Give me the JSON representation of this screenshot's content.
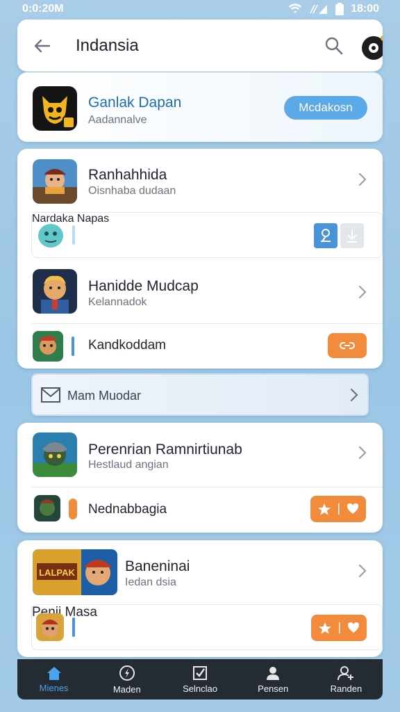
{
  "status_bar": {
    "time": "0:0:20M",
    "clock": "18:00"
  },
  "header": {
    "title": "Indansia",
    "back_icon": "arrow-left-icon",
    "search_icon": "search-icon",
    "profile_icon": "avatar-icon"
  },
  "featured": {
    "name": "Ganlak Dapan",
    "subtitle": "Aadannalve",
    "button": "Mcdakosn"
  },
  "group1": {
    "item1": {
      "title": "Ranhahhida",
      "subtitle": "Oisnhaba dudaan"
    },
    "item2": {
      "title": "Nardaka Napas"
    },
    "item3": {
      "title": "Hanidde Mudcap",
      "subtitle": "Kelannadok"
    },
    "item4": {
      "title": "Kandkoddam"
    }
  },
  "mail_bar": {
    "label": "Mam Muodar"
  },
  "group2": {
    "item1": {
      "title": "Perenrian Ramnirtiunab",
      "subtitle": "Hestlaud angian"
    },
    "item2": {
      "title": "Nednabbagia"
    }
  },
  "group3": {
    "item1": {
      "title": "Baneninai",
      "subtitle": "Iedan dsia"
    },
    "item2": {
      "title": "Penii Masa"
    }
  },
  "bottom_nav": [
    {
      "label": "Mienes",
      "icon": "home-icon"
    },
    {
      "label": "Maden",
      "icon": "compass-icon"
    },
    {
      "label": "Selnclao",
      "icon": "checkbox-icon"
    },
    {
      "label": "Pensen",
      "icon": "person-icon"
    },
    {
      "label": "Randen",
      "icon": "user-add-icon"
    }
  ],
  "colors": {
    "accent_blue": "#5ba9e6",
    "accent_orange": "#f28b3c",
    "nav_bg": "#252b33"
  }
}
